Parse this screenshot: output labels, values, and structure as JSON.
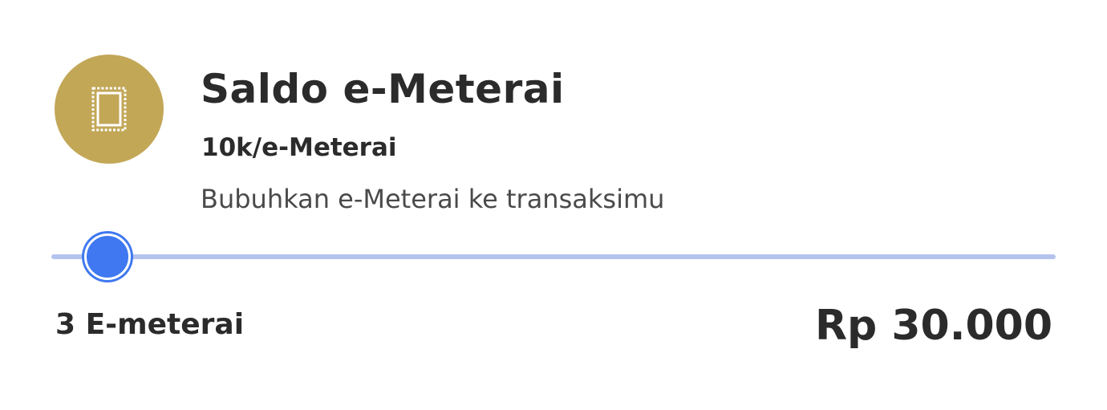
{
  "product": {
    "icon": "stamp-icon",
    "title": "Saldo e-Meterai",
    "rate": "10k/e-Meterai",
    "description": "Bubuhkan e-Meterai ke transaksimu"
  },
  "quantity_slider": {
    "value_fraction": 0.056
  },
  "summary": {
    "count_label": "3 E-meterai",
    "price": "Rp 30.000"
  },
  "colors": {
    "badge": "#c2a757",
    "accent": "#3f78f0",
    "track": "#b4c3ee"
  }
}
